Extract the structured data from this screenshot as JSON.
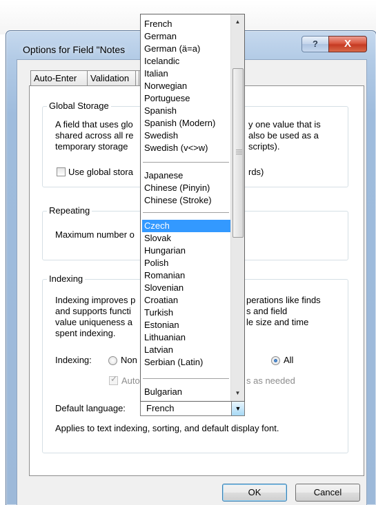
{
  "dialog": {
    "title": "Options for Field \"Notes",
    "help_label": "?",
    "close_label": "X"
  },
  "tabs": [
    {
      "label": "Auto-Enter"
    },
    {
      "label": "Validation"
    }
  ],
  "global_storage": {
    "legend": "Global Storage",
    "lines": [
      "A field that uses glo",
      "shared across all re",
      "temporary storage"
    ],
    "right_lines": [
      "y one value that is",
      "also be used as a",
      "scripts)."
    ],
    "checkbox_label": "Use global stora",
    "checkbox_suffix": "rds)"
  },
  "repeating": {
    "legend": "Repeating",
    "label": "Maximum number o"
  },
  "indexing": {
    "legend": "Indexing",
    "lines": [
      "Indexing improves p",
      "and supports functi",
      "value uniqueness a",
      "spent indexing."
    ],
    "right_lines": [
      "perations like finds",
      "s and field",
      "le size and time"
    ],
    "indexing_label": "Indexing:",
    "option_none": "Non",
    "option_all": "All",
    "auto_label": "Auto",
    "auto_suffix": "s as needed",
    "default_language_label": "Default language:",
    "default_language_value": "French",
    "note": "Applies to text indexing, sorting, and default display font."
  },
  "dropdown": {
    "group1": [
      "French",
      "German",
      "German (ä=a)",
      "Icelandic",
      "Italian",
      "Norwegian",
      "Portuguese",
      "Spanish",
      "Spanish (Modern)",
      "Swedish",
      "Swedish (v<>w)"
    ],
    "group2": [
      "Japanese",
      "Chinese (Pinyin)",
      "Chinese (Stroke)"
    ],
    "group3": [
      "Czech",
      "Slovak",
      "Hungarian",
      "Polish",
      "Romanian",
      "Slovenian",
      "Croatian",
      "Turkish",
      "Estonian",
      "Lithuanian",
      "Latvian",
      "Serbian (Latin)"
    ],
    "group4": [
      "Bulgarian"
    ],
    "selected": "Czech"
  },
  "buttons": {
    "ok": "OK",
    "cancel": "Cancel"
  }
}
